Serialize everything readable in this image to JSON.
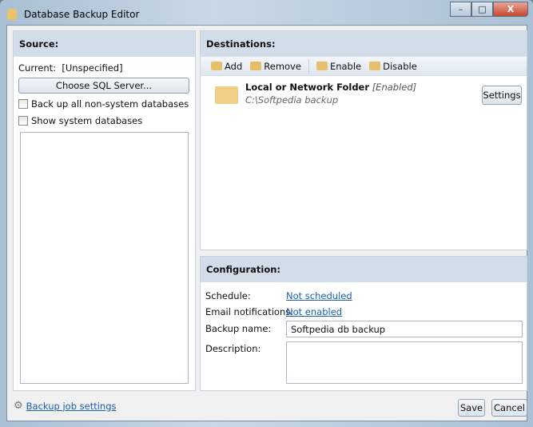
{
  "window": {
    "title": "Database Backup Editor",
    "minimize": "–",
    "maximize": "□",
    "close": "X"
  },
  "source": {
    "header": "Source:",
    "current_label": "Current:",
    "current_value": "[Unspecified]",
    "choose_button": "Choose SQL Server...",
    "checkboxes": [
      {
        "label": "Back up all non-system databases",
        "checked": false
      },
      {
        "label": "Show system databases",
        "checked": false
      }
    ]
  },
  "destinations": {
    "header": "Destinations:",
    "toolbar": {
      "add": "Add",
      "remove": "Remove",
      "enable": "Enable",
      "disable": "Disable"
    },
    "items": [
      {
        "name": "Local or Network Folder",
        "status": "[Enabled]",
        "path": "C:\\Softpedia backup",
        "settings": "Settings"
      }
    ]
  },
  "configuration": {
    "header": "Configuration:",
    "schedule_label": "Schedule:",
    "schedule_value": "Not scheduled",
    "email_label": "Email notifications:",
    "email_value": "Not enabled",
    "backup_name_label": "Backup name:",
    "backup_name_value": "Softpedia db backup",
    "description_label": "Description:",
    "description_value": ""
  },
  "footer": {
    "job_settings": "Backup job settings",
    "save": "Save",
    "cancel": "Cancel"
  }
}
